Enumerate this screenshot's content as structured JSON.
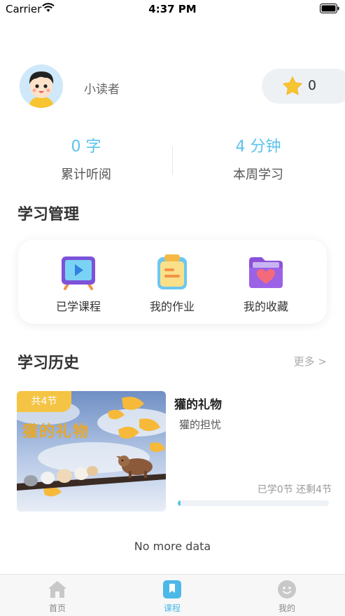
{
  "status_bar": {
    "carrier": "Carrier",
    "time": "4:37 PM"
  },
  "profile": {
    "username": "小读者",
    "star_count": "0"
  },
  "stats": {
    "words": {
      "value": "0 字",
      "label": "累计听阅"
    },
    "minutes": {
      "value": "4 分钟",
      "label": "本周学习"
    }
  },
  "manage": {
    "title": "学习管理",
    "items": [
      {
        "label": "已学课程",
        "icon": "tv-play-icon"
      },
      {
        "label": "我的作业",
        "icon": "clipboard-icon"
      },
      {
        "label": "我的收藏",
        "icon": "heart-folder-icon"
      }
    ]
  },
  "history": {
    "title": "学习历史",
    "more": "更多 >",
    "course": {
      "tag": "共4节",
      "cover_title": "獾的礼物",
      "title": "獾的礼物",
      "subtitle": "獾的担忧",
      "progress_text": "已学0节  还剩4节",
      "progress": 0.02
    }
  },
  "footer": {
    "no_more": "No more data"
  },
  "tabbar": {
    "tabs": [
      {
        "label": "首页",
        "icon": "home-icon",
        "active": false
      },
      {
        "label": "课程",
        "icon": "book-icon",
        "active": true
      },
      {
        "label": "我的",
        "icon": "user-face-icon",
        "active": false
      }
    ]
  },
  "colors": {
    "accent": "#5bc3ec",
    "tag": "#f5c444",
    "star": "#f7c531"
  }
}
